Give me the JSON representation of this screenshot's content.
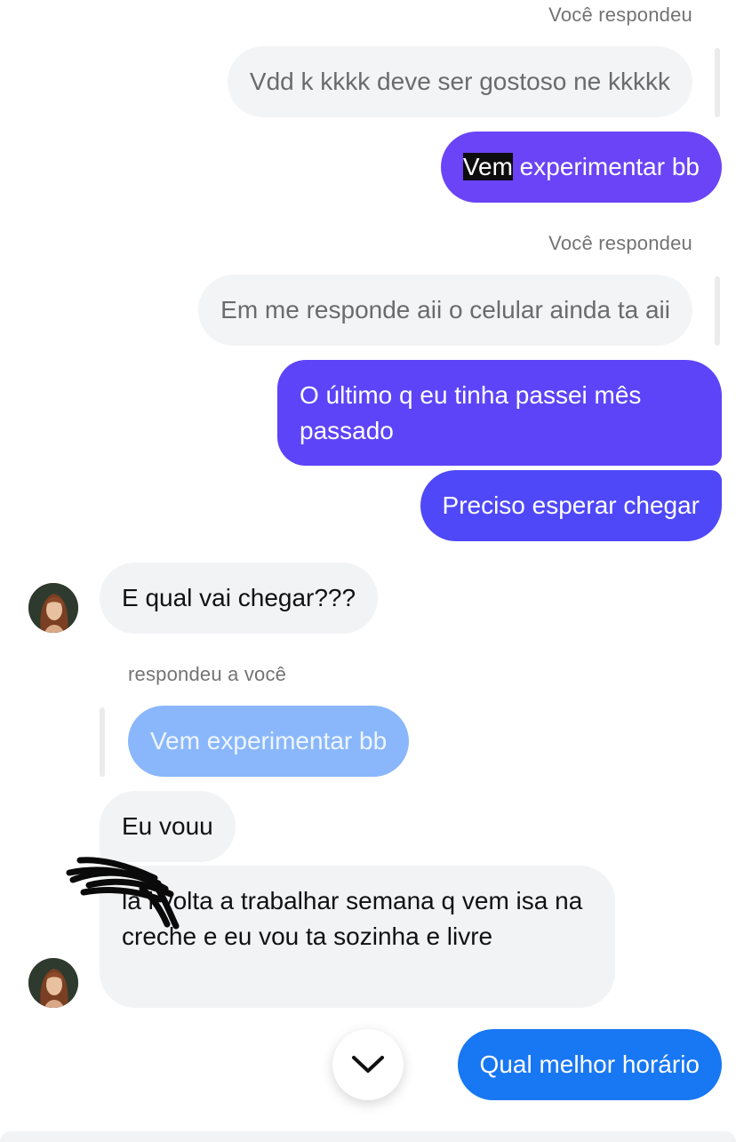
{
  "conversation": {
    "reply_label_top": "Você respondeu",
    "quoted_1": "Vdd k kkkk deve ser gostoso ne kkkkk",
    "mine_1_highlight": "Vem",
    "mine_1_rest": " experimentar bb",
    "reply_label_2": "Você respondeu",
    "quoted_2": "Em me responde aii o celular ainda ta aii",
    "mine_2": "O último q eu tinha passei mês passado",
    "mine_3": "Preciso esperar chegar",
    "theirs_1": "E qual vai chegar???",
    "reply_label_3": "respondeu a você",
    "quoted_3": "Vem experimentar bb",
    "theirs_2": "Eu vouu",
    "theirs_3": "la l volta a trabalhar semana q vem isa na creche e eu vou ta sozinha e livre",
    "mine_4": "Qual melhor horário"
  },
  "colors": {
    "mine_bubble_1": "#6a44f6",
    "mine_bubble_2": "#5d44f8",
    "mine_bubble_3": "#4f48f8",
    "mine_bubble_4": "#1877f2"
  },
  "icons": {
    "scroll_button": "chevron-down-icon",
    "redaction": "scribble-redaction"
  }
}
